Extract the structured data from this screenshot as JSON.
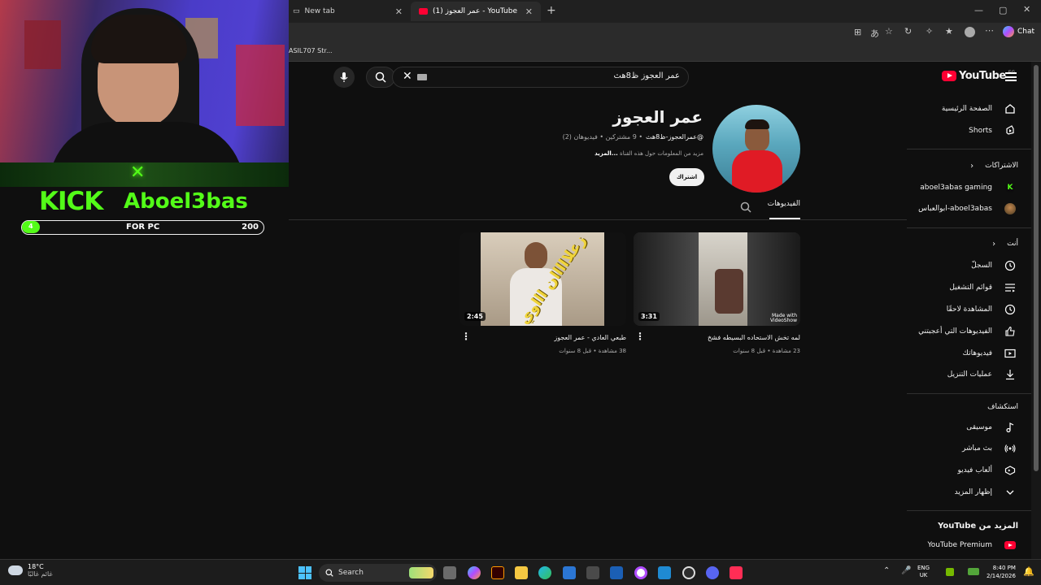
{
  "browser": {
    "tabs": [
      {
        "label": "New tab"
      },
      {
        "label": "YouTube - عمر العجوز (1)"
      }
    ],
    "bookmark": "ASIL707 Str...",
    "chat_label": "Chat"
  },
  "youtube": {
    "logo_text": "YouTube",
    "logo_region": "EG",
    "search_value": "عمر العجوز ظ8هث",
    "channel": {
      "name": "عمر العجوز",
      "handle": "@عمرالعجوز-ظ8هث",
      "stats": "• 9 مشتركين • فيديوهان (2)",
      "about": "مزيد من المعلومات حول هذه القناة",
      "more": "...المزيد",
      "subscribe": "اشتراك",
      "tab_videos": "الفيديوهات"
    },
    "videos": [
      {
        "title": "طبعي العادي - عمر العجوز",
        "meta": "38 مشاهدة • قبل 8 سنوات",
        "duration": "2:45",
        "overlay_text": "زعلااااان اااوي"
      },
      {
        "title": "لمه تخش الاستحاده البسيطه فشخ",
        "meta": "23 مشاهدة • قبل 8 سنوات",
        "duration": "3:31",
        "watermark": "Made with VideoShow"
      }
    ],
    "sidebar": {
      "main": [
        {
          "label": "الصفحة الرئيسية",
          "icon": "home-icon"
        },
        {
          "label": "Shorts",
          "icon": "shorts-icon"
        }
      ],
      "subs_header": "الاشتراكات",
      "subs": [
        {
          "label": "aboel3abas gaming",
          "icon": "kick-icon"
        },
        {
          "label": "ابوالعباس-aboel3abas",
          "icon": "avatar"
        }
      ],
      "you_header": "أنت",
      "you": [
        {
          "label": "السجلّ",
          "icon": "history-icon"
        },
        {
          "label": "قوائم التشغيل",
          "icon": "playlist-icon"
        },
        {
          "label": "المشاهدة لاحقًا",
          "icon": "clock-icon"
        },
        {
          "label": "الفيديوهات التي أعجبتني",
          "icon": "like-icon"
        },
        {
          "label": "فيديوهاتك",
          "icon": "video-icon"
        },
        {
          "label": "عمليات التنزيل",
          "icon": "download-icon"
        }
      ],
      "explore_header": "استكشاف",
      "explore": [
        {
          "label": "موسيقى",
          "icon": "music-icon"
        },
        {
          "label": "بث مباشر",
          "icon": "live-icon"
        },
        {
          "label": "ألعاب فيديو",
          "icon": "gaming-icon"
        },
        {
          "label": "إظهار المزيد",
          "icon": "chevron-down-icon"
        }
      ],
      "more_header": "المزيد من YouTube",
      "premium": "YouTube Premium"
    }
  },
  "overlay": {
    "brand": "KICK",
    "streamer": "Aboel3bas",
    "bar_left": "4",
    "bar_label": "FOR PC",
    "bar_right": "200"
  },
  "taskbar": {
    "weather_temp": "18°C",
    "weather_text": "غائم غالبًا",
    "search_placeholder": "Search",
    "lang1": "ENG",
    "lang2": "UK",
    "time": "8:40 PM",
    "date": "2/14/2026"
  },
  "colors": {
    "accent_red": "#ff0033",
    "kick_green": "#53fc18"
  }
}
